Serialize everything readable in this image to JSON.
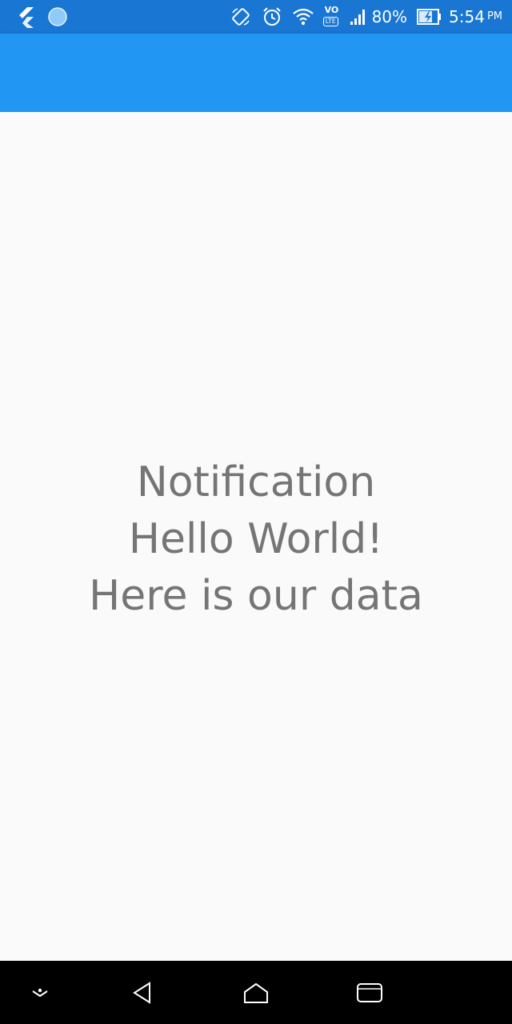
{
  "status_bar": {
    "battery_percent": "80%",
    "time": "5:54",
    "ampm": "PM",
    "network_badge_top": "VO",
    "network_badge_bottom": "LTE",
    "icons": [
      "flutter-icon",
      "circle-app-icon",
      "rotate-icon",
      "alarm-icon",
      "wifi-icon",
      "volte-icon",
      "signal-icon",
      "battery-charging-icon"
    ]
  },
  "app_bar": {
    "color": "#2196f3"
  },
  "body": {
    "lines": [
      "Notification",
      "Hello World!",
      "Here is our data"
    ],
    "text_color": "#757575"
  },
  "nav_bar": {
    "icons": [
      "expand-down-icon",
      "back-icon",
      "home-icon",
      "recents-icon"
    ]
  }
}
